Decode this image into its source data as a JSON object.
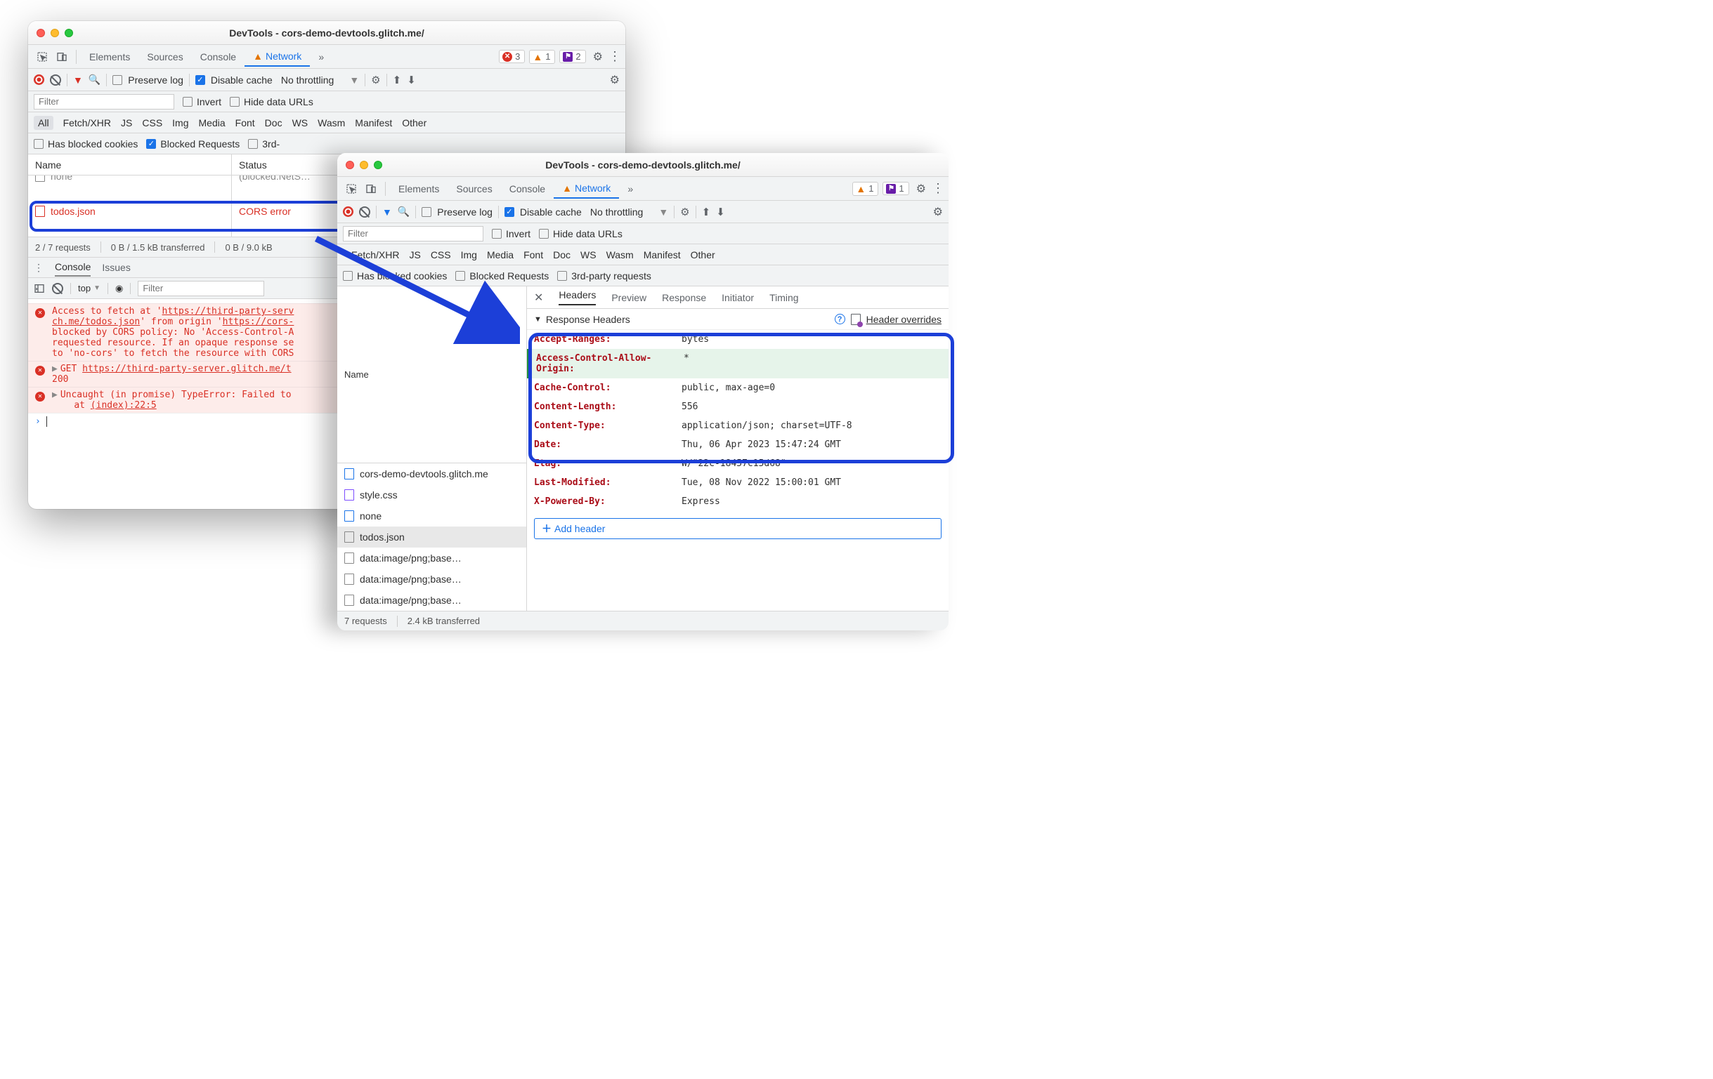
{
  "window1": {
    "title": "DevTools - cors-demo-devtools.glitch.me/",
    "tabs": {
      "elements": "Elements",
      "sources": "Sources",
      "console": "Console",
      "network": "Network"
    },
    "badges": {
      "errors": "3",
      "warnings": "1",
      "issues": "2"
    },
    "toolbar": {
      "preserve_log": "Preserve log",
      "disable_cache": "Disable cache",
      "throttle": "No throttling"
    },
    "filter": {
      "placeholder": "Filter",
      "invert": "Invert",
      "hide_data_urls": "Hide data URLs"
    },
    "types": [
      "All",
      "Fetch/XHR",
      "JS",
      "CSS",
      "Img",
      "Media",
      "Font",
      "Doc",
      "WS",
      "Wasm",
      "Manifest",
      "Other"
    ],
    "blocked": {
      "has_blocked_cookies": "Has blocked cookies",
      "blocked_requests": "Blocked Requests",
      "third_party": "3rd-"
    },
    "nettable": {
      "name_header": "Name",
      "status_header": "Status",
      "rows": [
        {
          "name": "none",
          "status": "(blocked:NetS…"
        },
        {
          "name": "todos.json",
          "status": "CORS error"
        }
      ]
    },
    "statusbar": {
      "requests": "2 / 7 requests",
      "transferred": "0 B / 1.5 kB transferred",
      "resources": "0 B / 9.0 kB"
    },
    "console": {
      "tabs": {
        "console": "Console",
        "issues": "Issues"
      },
      "context": "top",
      "filter_placeholder": "Filter",
      "msg1a": "Access to fetch at '",
      "msg1b": "https://third-party-serv",
      "msg1c": "ch.me/todos.json",
      "msg1d": "' from origin '",
      "msg1e": "https://cors-",
      "msg1f": "blocked by CORS policy: No 'Access-Control-A",
      "msg1g": "requested resource. If an opaque response se",
      "msg1h": "to 'no-cors' to fetch the resource with CORS",
      "msg2a": "GET ",
      "msg2b": "https://third-party-server.glitch.me/t",
      "msg2c": "200",
      "msg3a": "Uncaught (in promise) TypeError: Failed to ",
      "msg3b": "at ",
      "msg3c": "(index):22:5"
    }
  },
  "window2": {
    "title": "DevTools - cors-demo-devtools.glitch.me/",
    "tabs": {
      "elements": "Elements",
      "sources": "Sources",
      "console": "Console",
      "network": "Network"
    },
    "badges": {
      "warnings": "1",
      "issues": "1"
    },
    "toolbar": {
      "preserve_log": "Preserve log",
      "disable_cache": "Disable cache",
      "throttle": "No throttling"
    },
    "filter": {
      "placeholder": "Filter",
      "invert": "Invert",
      "hide_data_urls": "Hide data URLs"
    },
    "types": [
      "Fetch/XHR",
      "JS",
      "CSS",
      "Img",
      "Media",
      "Font",
      "Doc",
      "WS",
      "Wasm",
      "Manifest",
      "Other"
    ],
    "blocked": {
      "has_blocked_cookies": "Has blocked cookies",
      "blocked_requests": "Blocked Requests",
      "third_party": "3rd-party requests"
    },
    "name_header": "Name",
    "requests_list": [
      "cors-demo-devtools.glitch.me",
      "style.css",
      "none",
      "todos.json",
      "data:image/png;base…",
      "data:image/png;base…",
      "data:image/png;base…"
    ],
    "detail": {
      "tabs": {
        "headers": "Headers",
        "preview": "Preview",
        "response": "Response",
        "initiator": "Initiator",
        "timing": "Timing"
      },
      "section": "Response Headers",
      "overrides_link": "Header overrides",
      "headers": [
        {
          "k": "Accept-Ranges:",
          "v": "bytes",
          "added": false
        },
        {
          "k": "Access-Control-Allow-Origin:",
          "v": "*",
          "added": true
        },
        {
          "k": "Cache-Control:",
          "v": "public, max-age=0",
          "added": false
        },
        {
          "k": "Content-Length:",
          "v": "556",
          "added": false
        },
        {
          "k": "Content-Type:",
          "v": "application/json; charset=UTF-8",
          "added": false
        },
        {
          "k": "Date:",
          "v": "Thu, 06 Apr 2023 15:47:24 GMT",
          "added": false
        },
        {
          "k": "Etag:",
          "v": "W/\"22c-18457c15d68\"",
          "added": false
        },
        {
          "k": "Last-Modified:",
          "v": "Tue, 08 Nov 2022 15:00:01 GMT",
          "added": false
        },
        {
          "k": "X-Powered-By:",
          "v": "Express",
          "added": false
        }
      ],
      "add_header": "Add header"
    },
    "statusbar": {
      "requests": "7 requests",
      "transferred": "2.4 kB transferred"
    }
  }
}
